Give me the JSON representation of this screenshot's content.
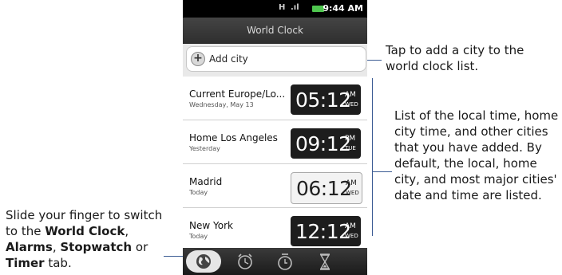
{
  "status_bar": {
    "time": "9:44 AM",
    "icons": [
      "network-h-icon",
      "signal-icon",
      "battery-icon"
    ]
  },
  "header": {
    "title": "World Clock"
  },
  "add_city": {
    "label": "Add city",
    "icon": "plus-icon"
  },
  "cities": [
    {
      "name": "Current  Europe/Lo...",
      "date": "Wednesday, May 13",
      "time": "05:12",
      "ampm": "AM",
      "day": "WED",
      "style": "dark"
    },
    {
      "name": "Home  Los Angeles",
      "date": "Yesterday",
      "time": "09:12",
      "ampm": "PM",
      "day": "TUE",
      "style": "dark"
    },
    {
      "name": "Madrid",
      "date": "Today",
      "time": "06:12",
      "ampm": "AM",
      "day": "WED",
      "style": "light"
    },
    {
      "name": "New York",
      "date": "Today",
      "time": "12:12",
      "ampm": "AM",
      "day": "WED",
      "style": "dark"
    }
  ],
  "tabs": [
    {
      "name": "World Clock",
      "icon": "globe-icon",
      "selected": true
    },
    {
      "name": "Alarms",
      "icon": "alarm-clock-icon",
      "selected": false
    },
    {
      "name": "Stopwatch",
      "icon": "stopwatch-icon",
      "selected": false
    },
    {
      "name": "Timer",
      "icon": "hourglass-icon",
      "selected": false
    }
  ],
  "annotations": {
    "add_city": "Tap to add a city to the world clock list.",
    "list": "List of the local time, home city time, and other cities that you have added. By default, the local, home city, and most major cities' date and time are listed.",
    "tabs": {
      "part1": "Slide your finger to switch to the ",
      "world": "World Clock",
      "sep1": ", ",
      "alarms": "Alarms",
      "sep2": ", ",
      "stopwatch": "Stopwatch",
      "sep3": " or ",
      "timer": "Timer",
      "part2": " tab."
    }
  },
  "colors": {
    "callout_line": "#3b5b93",
    "battery": "#4fc64f"
  }
}
